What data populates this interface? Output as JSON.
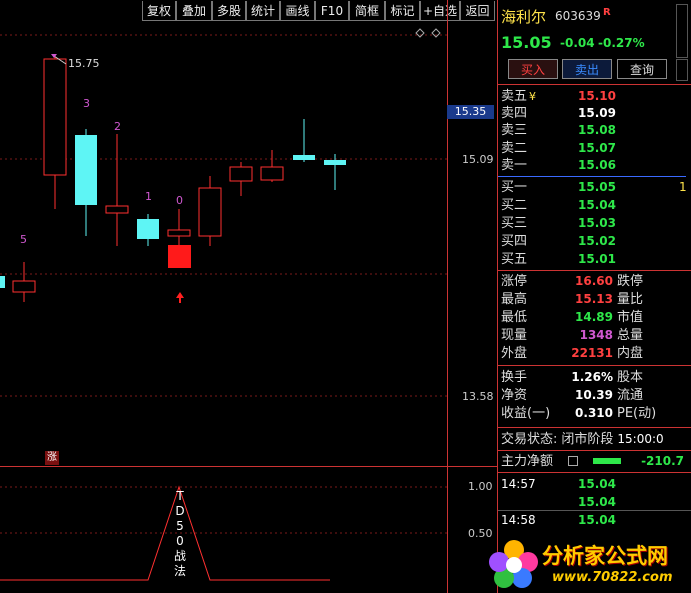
{
  "toolbar": {
    "items": [
      "复权",
      "叠加",
      "多股",
      "统计",
      "画线",
      "F10",
      "简框",
      "标记",
      "+自选",
      "返回"
    ]
  },
  "chart": {
    "high_label": "15.75",
    "current_price_box": "15.35",
    "scale_labels": [
      "15.09",
      "13.58"
    ],
    "counts": [
      "5",
      "3",
      "2",
      "1",
      "0"
    ],
    "zhang_badge": "涨",
    "indicator_scale": [
      "1.00",
      "0.50"
    ],
    "indicator_text": [
      "T",
      "D",
      "5",
      "0",
      "战",
      "法"
    ],
    "colors": {
      "up": "#ff2020",
      "down": "#5ef5f5",
      "count": "#d058d0"
    }
  },
  "stock": {
    "name": "海利尔",
    "code": "603639",
    "flag": "R",
    "price": "15.05",
    "change": "-0.04",
    "change_pct": "-0.27%"
  },
  "buttons": {
    "buy": "买入",
    "sell": "卖出",
    "query": "查询"
  },
  "asks": [
    {
      "label": "卖五",
      "price": "15.10"
    },
    {
      "label": "卖四",
      "price": "15.09"
    },
    {
      "label": "卖三",
      "price": "15.08"
    },
    {
      "label": "卖二",
      "price": "15.07"
    },
    {
      "label": "卖一",
      "price": "15.06"
    }
  ],
  "bids": [
    {
      "label": "买一",
      "price": "15.05"
    },
    {
      "label": "买二",
      "price": "15.04"
    },
    {
      "label": "买三",
      "price": "15.03"
    },
    {
      "label": "买四",
      "price": "15.02"
    },
    {
      "label": "买五",
      "price": "15.01"
    }
  ],
  "stats": [
    {
      "label": "涨停",
      "value": "16.60",
      "label2": "跌停"
    },
    {
      "label": "最高",
      "value": "15.13",
      "label2": "量比"
    },
    {
      "label": "最低",
      "value": "14.89",
      "label2": "市值"
    },
    {
      "label": "现量",
      "value": "1348",
      "label2": "总量"
    },
    {
      "label": "外盘",
      "value": "22131",
      "label2": "内盘"
    }
  ],
  "fundamentals": [
    {
      "label": "换手",
      "value": "1.26%",
      "label2": "股本"
    },
    {
      "label": "净资",
      "value": "10.39",
      "label2": "流通"
    },
    {
      "label": "收益(一)",
      "value": "0.310",
      "label2": "PE(动)"
    }
  ],
  "trade_status": {
    "label": "交易状态:",
    "value": "闭市阶段",
    "time": "15:00:0"
  },
  "mainforce": {
    "label": "主力净额",
    "value": "-210.7"
  },
  "ticks": [
    {
      "time": "14:57",
      "price": "15.04"
    },
    {
      "time": "",
      "price": "15.04"
    },
    {
      "time": "14:58",
      "price": "15.04"
    }
  ],
  "watermark": {
    "text": "分析家公式网",
    "url": "www.70822.com"
  }
}
